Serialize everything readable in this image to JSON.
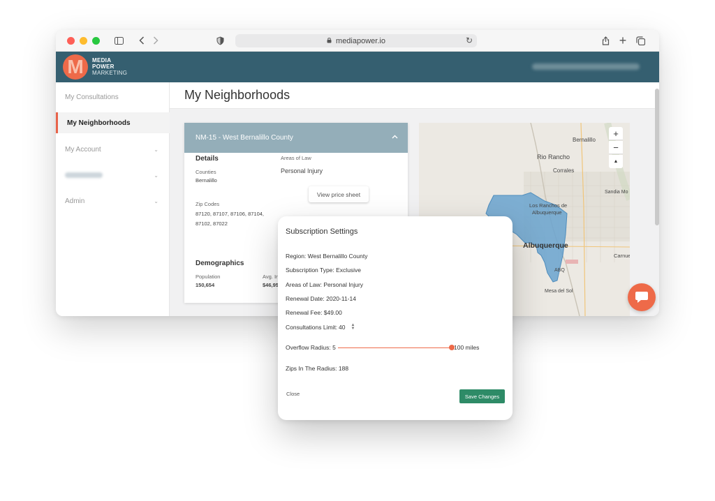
{
  "browser": {
    "url": "mediapower.io"
  },
  "brand": {
    "line1": "MEDIA",
    "line2": "POWER",
    "line3": "MARKETING",
    "logo_letter": "M",
    "accent_color": "#ee6a49",
    "header_color": "#355f70"
  },
  "sidebar": {
    "items": [
      {
        "label": "My Consultations"
      },
      {
        "label": "My Neighborhoods"
      },
      {
        "label": "My Account"
      },
      {
        "label": "Admin"
      }
    ]
  },
  "page": {
    "title": "My Neighborhoods"
  },
  "card": {
    "header": "NM-15 - West Bernalillo County",
    "details_title": "Details",
    "counties_label": "Counties",
    "counties_value": "Bernalillo",
    "zip_label": "Zip Codes",
    "zip_line1": "87120, 87107, 87106, 87104,",
    "zip_line2": "87102, 87022",
    "areas_label": "Areas of Law",
    "areas_value": "Personal Injury",
    "price_button": "View price sheet",
    "demographics_title": "Demographics",
    "population_label": "Population",
    "population_value": "150,654",
    "avg_label": "Avg. In",
    "avg_value": "$46,95"
  },
  "map": {
    "labels": [
      "Bernalillo",
      "Rio Rancho",
      "Corrales",
      "Sandia Mo",
      "Los Ranchos de",
      "Albuquerque",
      "Albuquerque",
      "Carnue",
      "ABQ",
      "Mesa del Sol"
    ],
    "zoom_in": "+",
    "zoom_out": "−",
    "compass": "▲"
  },
  "modal": {
    "title": "Subscription Settings",
    "region": "Region: West Bernalillo County",
    "type": "Subscription Type: Exclusive",
    "areas": "Areas of Law: Personal Injury",
    "renewal_date": "Renewal Date: 2020-11-14",
    "renewal_fee": "Renewal Fee: $49.00",
    "limit_label": "Consultations Limit:",
    "limit_value": "40",
    "radius_label": "Overflow Radius: 5",
    "radius_max": "100 miles",
    "zips": "Zips In The Radius: 188",
    "close": "Close",
    "save": "Save Changes",
    "save_color": "#2e8b67"
  }
}
